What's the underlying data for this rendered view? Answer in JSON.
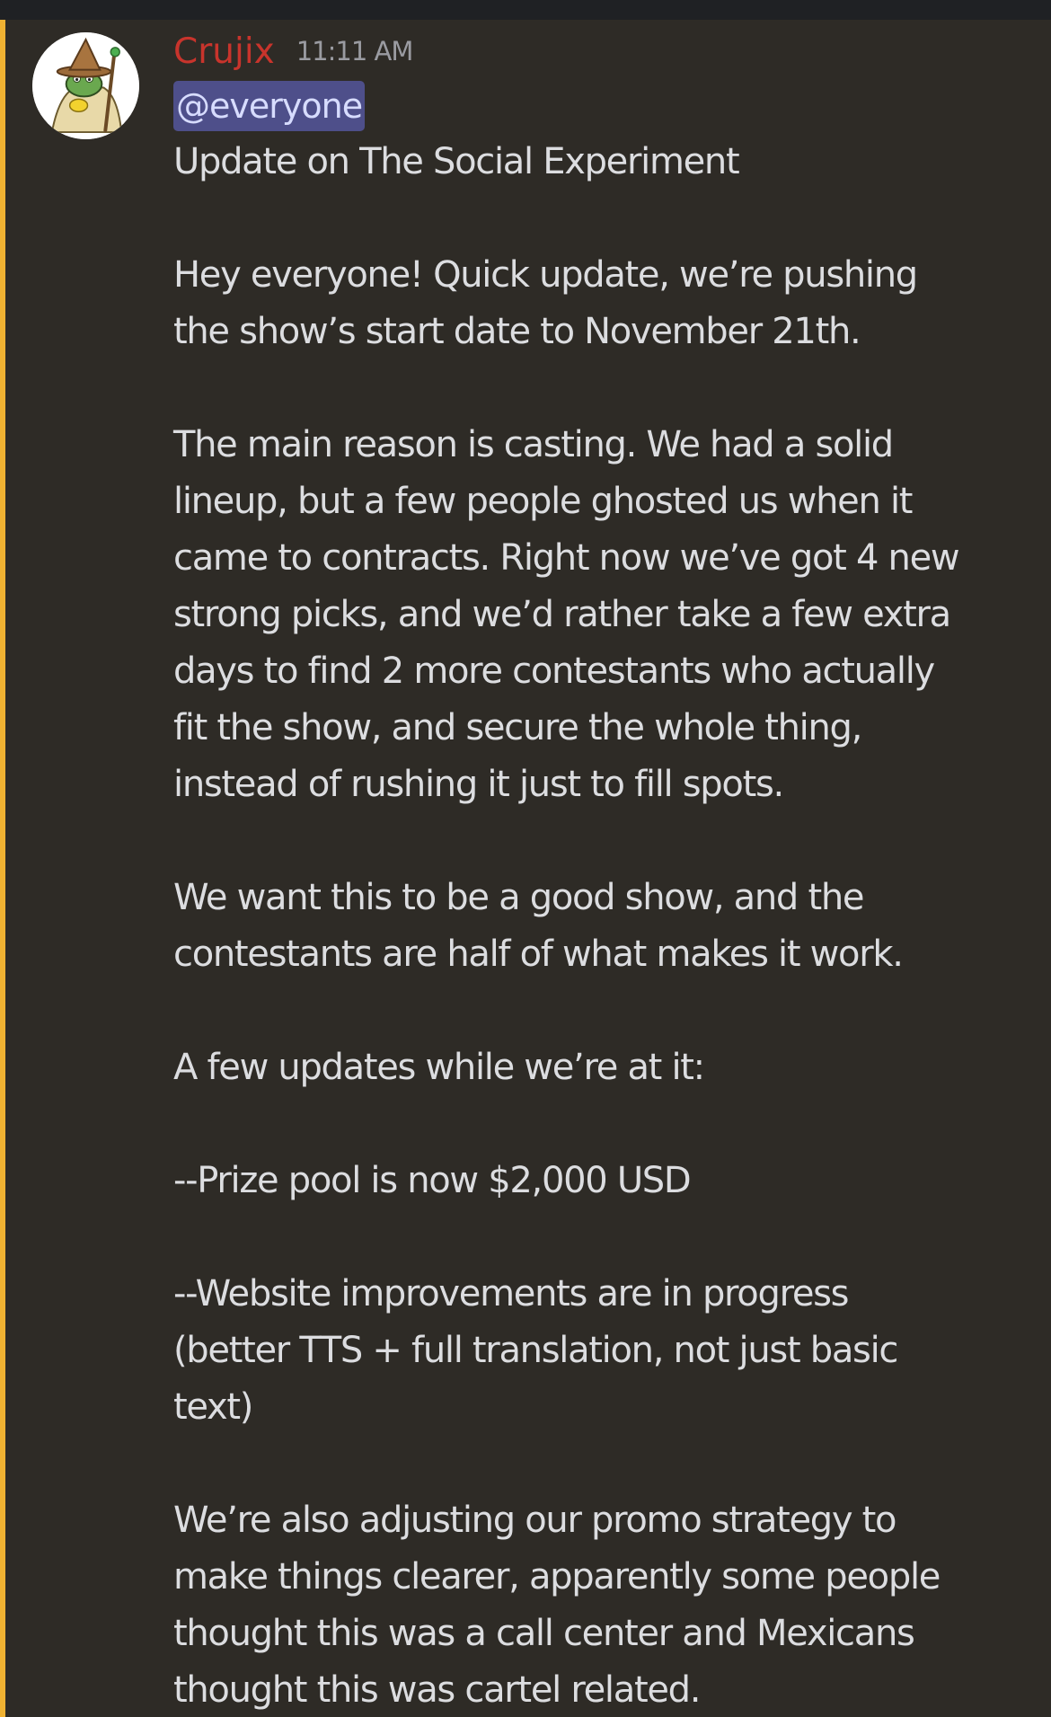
{
  "message": {
    "author": "Crujix",
    "timestamp": "11:11 AM",
    "mention": "@everyone",
    "title": "Update on The Social Experiment",
    "paragraphs": [
      [
        "Hey everyone! Quick update, we’re pushing",
        "the show’s start date to November 21th."
      ],
      [
        "The main reason is casting. We had a solid",
        "lineup, but a few people ghosted us when it",
        "came to contracts. Right now we’ve got 4 new",
        "strong picks, and we’d rather take a few extra",
        "days to find 2 more contestants who actually",
        "fit the show, and secure the whole thing,",
        "instead of rushing it just to fill spots."
      ],
      [
        "We want this to be a good show, and the",
        "contestants are half of what makes it work."
      ],
      [
        "A few updates while we’re at it:"
      ],
      [
        "--Prize pool is now $2,000 USD"
      ],
      [
        "--Website improvements are in progress",
        "(better TTS + full translation, not just basic",
        "text)"
      ],
      [
        "We’re also adjusting our promo strategy to",
        "make things clearer, apparently some people",
        "thought this was a call center and Mexicans",
        "thought this was cartel related."
      ]
    ]
  },
  "colors": {
    "background": "#2e2b26",
    "top_bar": "#1f2124",
    "mention_accent": "#f0b232",
    "author": "#c8342c",
    "timestamp": "#9a9ba1",
    "mention_bg": "#4e4f8a",
    "mention_text": "#d7dcff",
    "body_text": "#dcdde0"
  },
  "icons": {
    "avatar": "wizard-frog-avatar-icon"
  }
}
